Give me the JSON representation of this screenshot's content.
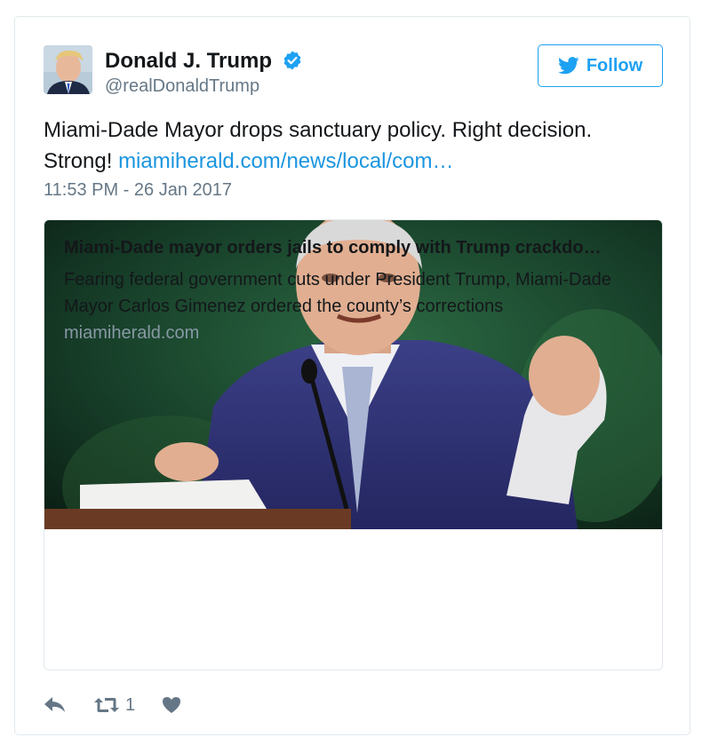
{
  "user": {
    "display_name": "Donald J. Trump",
    "screen_name": "@realDonaldTrump",
    "verified": true
  },
  "follow_button": {
    "label": "Follow",
    "icon": "twitter-bird-icon"
  },
  "tweet": {
    "text": "Miami-Dade Mayor drops sanctuary policy. Right decision. Strong!",
    "link_text": "miamiherald.com/news/local/com…",
    "timestamp": "11:53 PM - 26 Jan 2017"
  },
  "card": {
    "title": "Miami-Dade mayor orders jails to comply with Trump crackdo…",
    "description": "Fearing federal government cuts under President Trump, Miami-Dade Mayor Carlos Gimenez ordered the county’s corrections",
    "domain": "miamiherald.com"
  },
  "actions": {
    "reply_icon": "reply-icon",
    "retweet_icon": "retweet-icon",
    "retweet_count": "1",
    "like_icon": "heart-icon"
  },
  "colors": {
    "accent": "#1da1f2",
    "link": "#1b95e0",
    "secondary_text": "#657786",
    "border": "#e1e8ed"
  }
}
